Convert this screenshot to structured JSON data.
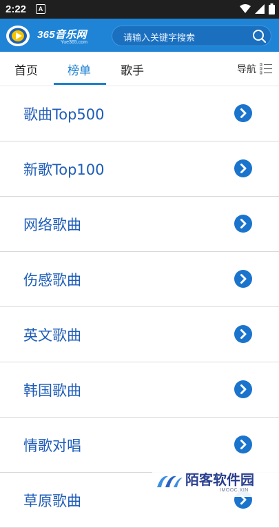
{
  "status_bar": {
    "time": "2:22",
    "notification_letter": "A"
  },
  "header": {
    "logo_text": "365音乐网",
    "logo_subtext": "Yue365.com",
    "search_placeholder": "请输入关键字搜索"
  },
  "tabs": [
    {
      "label": "首页",
      "active": false
    },
    {
      "label": "榜单",
      "active": true
    },
    {
      "label": "歌手",
      "active": false
    }
  ],
  "nav": {
    "label": "导航"
  },
  "list_items": [
    {
      "label": "歌曲Top500"
    },
    {
      "label": "新歌Top100"
    },
    {
      "label": "网络歌曲"
    },
    {
      "label": "伤感歌曲"
    },
    {
      "label": "英文歌曲"
    },
    {
      "label": "韩国歌曲"
    },
    {
      "label": "情歌对唱"
    },
    {
      "label": "草原歌曲"
    }
  ],
  "watermark": {
    "title": "陌客软件园",
    "subtitle": "IMOOC.XIN"
  },
  "colors": {
    "header_bg": "#1f84d6",
    "accent": "#1b7fd0",
    "item_text": "#1f5db8"
  }
}
